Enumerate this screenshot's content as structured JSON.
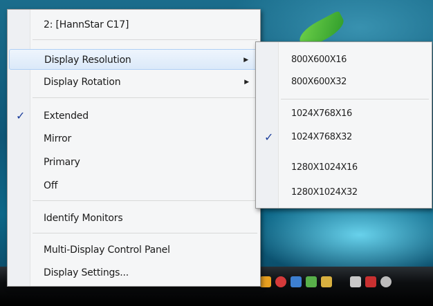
{
  "main_menu": {
    "header": "2: [HannStar C17]",
    "items": [
      {
        "label": "Display Resolution",
        "has_submenu": true,
        "highlighted": true
      },
      {
        "label": "Display Rotation",
        "has_submenu": true
      },
      {
        "label": "Extended",
        "checked": true
      },
      {
        "label": "Mirror"
      },
      {
        "label": "Primary"
      },
      {
        "label": "Off"
      },
      {
        "label": "Identify Monitors"
      },
      {
        "label": "Multi-Display Control Panel"
      },
      {
        "label": "Display Settings..."
      }
    ]
  },
  "resolution_submenu": {
    "items": [
      {
        "label": "800X600X16"
      },
      {
        "label": "800X600X32"
      },
      {
        "label": "1024X768X16"
      },
      {
        "label": "1024X768X32",
        "checked": true
      },
      {
        "label": "1280X1024X16"
      },
      {
        "label": "1280X1024X32"
      }
    ]
  },
  "icons": {
    "check": "checkmark-icon",
    "submenu_arrow": "triangle-right-icon"
  },
  "colors": {
    "highlight": "#dbe9f9",
    "check": "#1d3f9c"
  }
}
